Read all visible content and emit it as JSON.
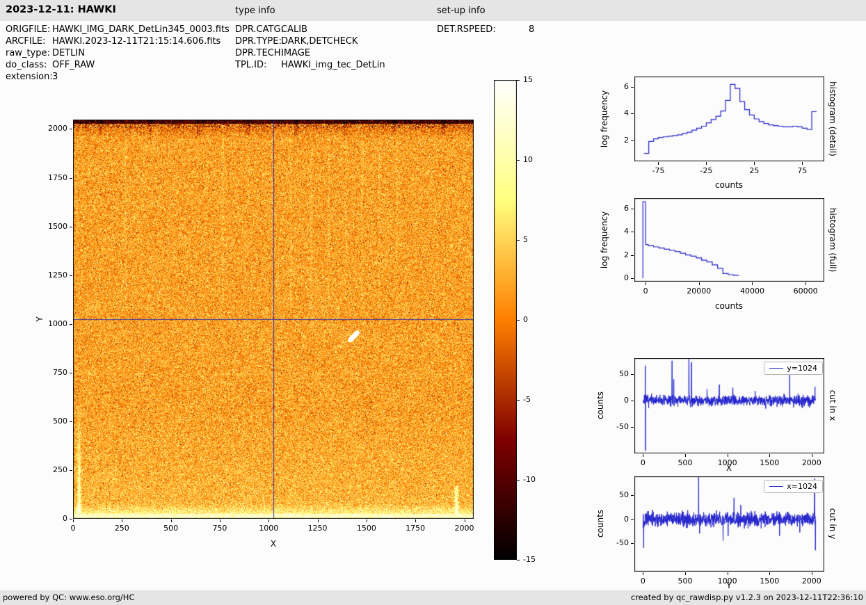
{
  "header": {
    "title": "2023-12-11: HAWKI",
    "type_info_heading": "type info",
    "setup_info_heading": "set-up info"
  },
  "file_info": [
    {
      "label": "ORIGFILE:",
      "value": "HAWKI_IMG_DARK_DetLin345_0003.fits"
    },
    {
      "label": "ARCFILE:",
      "value": "HAWKI.2023-12-11T21:15:14.606.fits"
    },
    {
      "label": "raw_type:",
      "value": "DETLIN"
    },
    {
      "label": "do_class:",
      "value": "OFF_RAW"
    },
    {
      "label": "extension:",
      "value": "3"
    }
  ],
  "type_info": [
    {
      "label": "DPR.CATG:",
      "value": "CALIB"
    },
    {
      "label": "DPR.TYPE:",
      "value": "DARK,DETCHECK"
    },
    {
      "label": "DPR.TECH:",
      "value": "IMAGE"
    },
    {
      "label": "TPL.ID:",
      "value": "HAWKI_img_tec_DetLin"
    }
  ],
  "setup_info": [
    {
      "label": "DET.RSPEED:",
      "value": "8"
    }
  ],
  "footer": {
    "left": "powered by QC: www.eso.org/HC",
    "right": "created by qc_rawdisp.py v1.2.3 on 2023-12-11T22:36:10"
  },
  "colors": {
    "line_blue": "#2222cc",
    "crosshair_blue": "#2525b5",
    "bar_bg": "#e5e5e5",
    "page_bg": "#fcfcfc"
  },
  "chart_data": [
    {
      "id": "detector_image",
      "type": "heatmap",
      "xlabel": "X",
      "ylabel": "Y",
      "xlim": [
        0,
        2048
      ],
      "ylim": [
        0,
        2048
      ],
      "xticks": [
        0,
        250,
        500,
        750,
        1000,
        1250,
        1500,
        1750,
        2000
      ],
      "yticks": [
        0,
        250,
        500,
        750,
        1000,
        1250,
        1500,
        1750,
        2000
      ],
      "value_range": [
        -15,
        15
      ],
      "colorbar_ticks": [
        15,
        10,
        5,
        0,
        -5,
        -10,
        -15
      ],
      "colormap": "black-darkred-red-orange-yellow-white (afmhot-like)",
      "crosshair": {
        "x": 1024,
        "y": 1024
      },
      "features": [
        "uniform orange noise field around 0-5 counts with yellow and dark speckles",
        "bright white rows along bottom edge",
        "dark black rows along top edge with dark smudges",
        "bright column hugging left edge up to y~550",
        "bright column at right edge up to y~170",
        "faint vertical striping in upper half",
        "small white cosmetic blob near (1430, 940) with faint diagonal trail",
        "blue crosshair lines at x=1024 and y=1024"
      ]
    },
    {
      "id": "histogram_detail",
      "type": "line",
      "style": "step",
      "right_label": "histogram (detail)",
      "xlabel": "counts",
      "ylabel": "log frequency",
      "xticks": [
        -75,
        -25,
        25,
        75
      ],
      "yticks": [
        2,
        4,
        6
      ],
      "xlim": [
        -100,
        98
      ],
      "ylim": [
        0.4,
        6.8
      ],
      "bin_edges": [
        -90,
        -85,
        -80,
        -75,
        -70,
        -65,
        -60,
        -55,
        -50,
        -45,
        -40,
        -35,
        -30,
        -25,
        -20,
        -15,
        -10,
        -5,
        0,
        5,
        10,
        15,
        20,
        25,
        30,
        35,
        40,
        45,
        50,
        55,
        60,
        65,
        70,
        75,
        80,
        85,
        90
      ],
      "values": [
        1.0,
        1.9,
        2.1,
        2.2,
        2.25,
        2.3,
        2.35,
        2.4,
        2.5,
        2.6,
        2.75,
        2.9,
        3.05,
        3.3,
        3.55,
        3.8,
        4.2,
        5.0,
        6.2,
        5.9,
        4.9,
        4.3,
        3.9,
        3.6,
        3.4,
        3.25,
        3.15,
        3.1,
        3.05,
        3.0,
        3.0,
        3.05,
        3.0,
        2.9,
        2.8,
        4.15
      ]
    },
    {
      "id": "histogram_full",
      "type": "line",
      "style": "step",
      "start_from_zero": true,
      "right_label": "histogram (full)",
      "xlabel": "counts",
      "ylabel": "log frequency",
      "xticks": [
        0,
        20000,
        40000,
        60000
      ],
      "yticks": [
        0,
        2,
        4,
        6
      ],
      "xlim": [
        -4200,
        67000
      ],
      "ylim": [
        -0.3,
        6.9
      ],
      "bin_edges": [
        -1000,
        0,
        1000,
        3000,
        5000,
        7000,
        9000,
        11000,
        13000,
        15000,
        17000,
        19000,
        21000,
        23000,
        25000,
        27000,
        29000,
        31000,
        33000,
        35000
      ],
      "values": [
        6.6,
        2.9,
        2.8,
        2.7,
        2.6,
        2.5,
        2.4,
        2.3,
        2.15,
        2.0,
        1.9,
        1.75,
        1.55,
        1.4,
        1.15,
        0.85,
        0.4,
        0.3,
        0.25
      ]
    },
    {
      "id": "cut_x",
      "type": "line",
      "legend": "y=1024",
      "right_label": "cut in x",
      "xlabel": "X",
      "ylabel": "counts",
      "xticks": [
        0,
        500,
        1000,
        1500,
        2000
      ],
      "yticks": [
        -50,
        0,
        50
      ],
      "xlim": [
        -102,
        2150
      ],
      "ylim": [
        -100,
        80
      ],
      "baseline": 0,
      "noise_sigma": 5,
      "spikes": [
        {
          "x": 28,
          "y": 78
        },
        {
          "x": 30,
          "y": -95
        },
        {
          "x": 345,
          "y": 75
        },
        {
          "x": 365,
          "y": 40
        },
        {
          "x": 545,
          "y": 78
        },
        {
          "x": 575,
          "y": 72
        },
        {
          "x": 760,
          "y": 22
        },
        {
          "x": 905,
          "y": 30
        },
        {
          "x": 1065,
          "y": 24
        },
        {
          "x": 1330,
          "y": 18
        },
        {
          "x": 1740,
          "y": 55
        },
        {
          "x": 2040,
          "y": 26
        }
      ]
    },
    {
      "id": "cut_y",
      "type": "line",
      "legend": "x=1024",
      "right_label": "cut in y",
      "xlabel": "Y",
      "ylabel": "counts",
      "xticks": [
        0,
        500,
        1000,
        1500,
        2000
      ],
      "yticks": [
        -50,
        0,
        50
      ],
      "xlim": [
        -102,
        2150
      ],
      "ylim": [
        -110,
        90
      ],
      "baseline": 0,
      "noise_sigma": 7,
      "spikes": [
        {
          "x": 8,
          "y": -60
        },
        {
          "x": 660,
          "y": 88
        },
        {
          "x": 672,
          "y": -30
        },
        {
          "x": 950,
          "y": -45
        },
        {
          "x": 1010,
          "y": -35
        },
        {
          "x": 1080,
          "y": 45
        },
        {
          "x": 1160,
          "y": 30
        },
        {
          "x": 1620,
          "y": -35
        },
        {
          "x": 1860,
          "y": -28
        },
        {
          "x": 2035,
          "y": 85
        },
        {
          "x": 2045,
          "y": -65
        }
      ]
    }
  ]
}
